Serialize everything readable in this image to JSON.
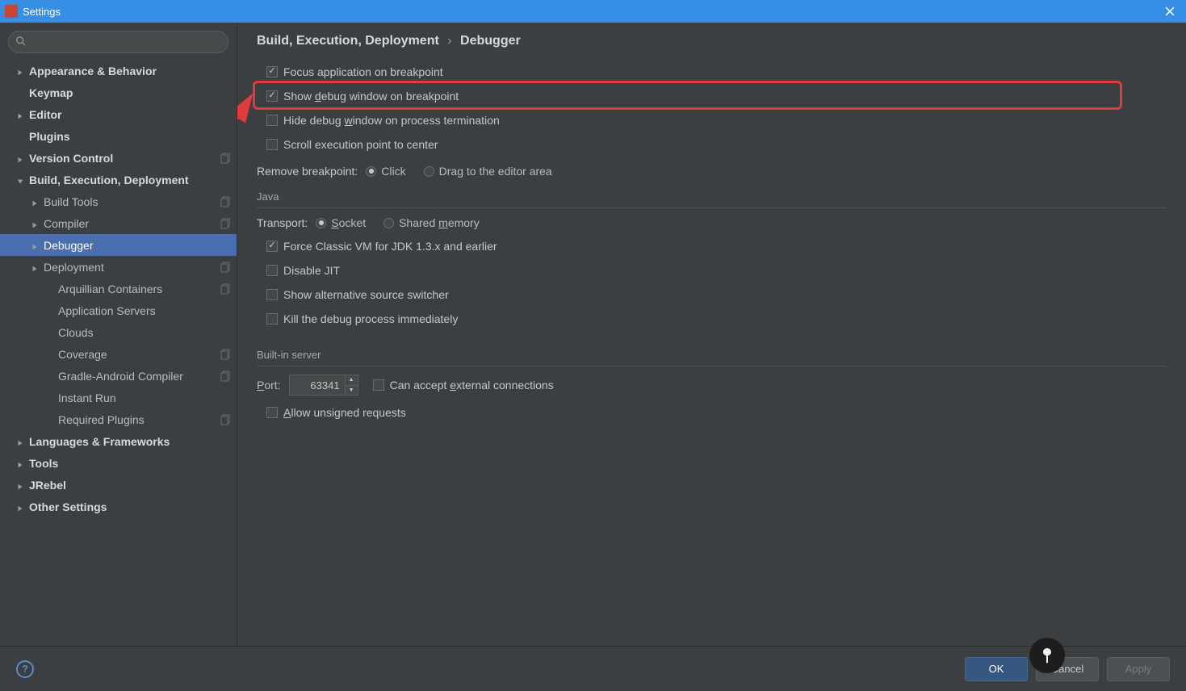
{
  "window": {
    "title": "Settings"
  },
  "search": {
    "placeholder": ""
  },
  "tree": [
    {
      "label": "Appearance & Behavior",
      "depth": 0,
      "arrow": "right",
      "bold": true
    },
    {
      "label": "Keymap",
      "depth": 0,
      "arrow": "none",
      "bold": true
    },
    {
      "label": "Editor",
      "depth": 0,
      "arrow": "right",
      "bold": true
    },
    {
      "label": "Plugins",
      "depth": 0,
      "arrow": "none",
      "bold": true
    },
    {
      "label": "Version Control",
      "depth": 0,
      "arrow": "right",
      "bold": true,
      "copy": true
    },
    {
      "label": "Build, Execution, Deployment",
      "depth": 0,
      "arrow": "down",
      "bold": true
    },
    {
      "label": "Build Tools",
      "depth": 1,
      "arrow": "right",
      "copy": true
    },
    {
      "label": "Compiler",
      "depth": 1,
      "arrow": "right",
      "copy": true
    },
    {
      "label": "Debugger",
      "depth": 1,
      "arrow": "right",
      "selected": true
    },
    {
      "label": "Deployment",
      "depth": 1,
      "arrow": "right",
      "copy": true
    },
    {
      "label": "Arquillian Containers",
      "depth": 2,
      "arrow": "none",
      "copy": true
    },
    {
      "label": "Application Servers",
      "depth": 2,
      "arrow": "none"
    },
    {
      "label": "Clouds",
      "depth": 2,
      "arrow": "none"
    },
    {
      "label": "Coverage",
      "depth": 2,
      "arrow": "none",
      "copy": true
    },
    {
      "label": "Gradle-Android Compiler",
      "depth": 2,
      "arrow": "none",
      "copy": true
    },
    {
      "label": "Instant Run",
      "depth": 2,
      "arrow": "none"
    },
    {
      "label": "Required Plugins",
      "depth": 2,
      "arrow": "none",
      "copy": true
    },
    {
      "label": "Languages & Frameworks",
      "depth": 0,
      "arrow": "right",
      "bold": true
    },
    {
      "label": "Tools",
      "depth": 0,
      "arrow": "right",
      "bold": true
    },
    {
      "label": "JRebel",
      "depth": 0,
      "arrow": "right",
      "bold": true
    },
    {
      "label": "Other Settings",
      "depth": 0,
      "arrow": "right",
      "bold": true
    }
  ],
  "crumb": {
    "parent": "Build, Execution, Deployment",
    "sep": "›",
    "leaf": "Debugger"
  },
  "checks_top": [
    {
      "label": "Focus application on breakpoint",
      "checked": true
    },
    {
      "label_html": "Show <span class=\"u\">d</span>ebug window on breakpoint",
      "checked": true,
      "highlight": true
    },
    {
      "label_html": "Hide debug <span class=\"u\">w</span>indow on process termination",
      "checked": false
    },
    {
      "label": "Scroll execution point to center",
      "checked": false
    }
  ],
  "remove_bp": {
    "label": "Remove breakpoint:",
    "options": [
      {
        "label": "Click",
        "checked": true
      },
      {
        "label": "Drag to the editor area",
        "checked": false
      }
    ]
  },
  "section_java": "Java",
  "transport": {
    "label": "Transport:",
    "options": [
      {
        "label_html": "<span class=\"ulet\">S</span>ocket",
        "checked": true
      },
      {
        "label_html": "Shared <span class=\"ulet\">m</span>emory",
        "checked": false
      }
    ]
  },
  "checks_java": [
    {
      "label": "Force Classic VM for JDK 1.3.x and earlier",
      "checked": true
    },
    {
      "label": "Disable JIT",
      "checked": false
    },
    {
      "label": "Show alternative source switcher",
      "checked": false
    },
    {
      "label": "Kill the debug process immediately",
      "checked": false
    }
  ],
  "section_server": "Built-in server",
  "port": {
    "label_html": "<span class=\"ulet\">P</span>ort:",
    "value": "63341",
    "accept_html": "Can accept <span class=\"u\">e</span>xternal connections",
    "accept_checked": false
  },
  "allow_unsigned": {
    "label_html": "<span class=\"ulet\">A</span>llow unsigned requests",
    "checked": false
  },
  "footer": {
    "ok": "OK",
    "cancel": "Cancel",
    "apply": "Apply"
  }
}
